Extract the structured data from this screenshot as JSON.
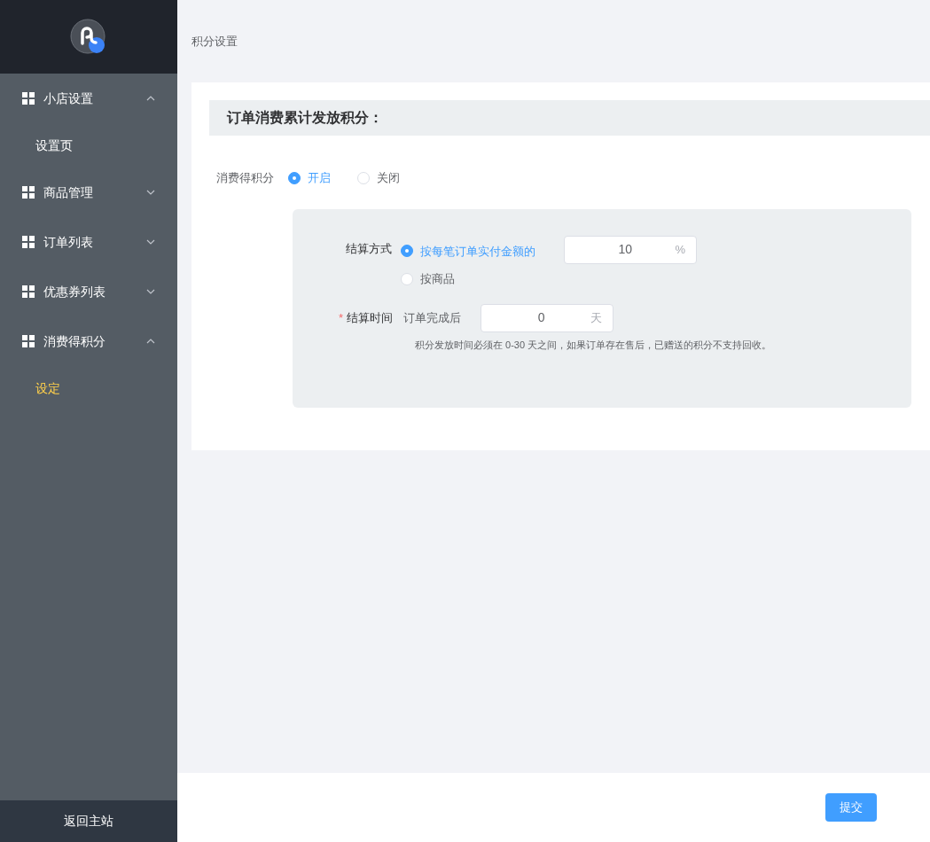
{
  "sidebar": {
    "groups": [
      {
        "label": "小店设置",
        "expanded": true,
        "children": [
          {
            "label": "设置页",
            "selected": false
          }
        ]
      },
      {
        "label": "商品管理",
        "expanded": false
      },
      {
        "label": "订单列表",
        "expanded": false
      },
      {
        "label": "优惠券列表",
        "expanded": false
      },
      {
        "label": "消费得积分",
        "expanded": true,
        "children": [
          {
            "label": "设定",
            "selected": true
          }
        ]
      }
    ],
    "footer_link": "返回主站"
  },
  "breadcrumb": "积分设置",
  "section_title": "订单消费累计发放积分：",
  "points_toggle": {
    "label": "消费得积分",
    "options": [
      {
        "label": "开启",
        "selected": true
      },
      {
        "label": "关闭",
        "selected": false
      }
    ]
  },
  "settlement_method": {
    "label": "结算方式",
    "options": [
      {
        "label": "按每笔订单实付金额的",
        "selected": true
      },
      {
        "label": "按商品",
        "selected": false
      }
    ],
    "input": {
      "value": "10",
      "suffix": "%"
    }
  },
  "settlement_time": {
    "required_mark": "*",
    "label": "结算时间",
    "prefix": "订单完成后",
    "input": {
      "value": "0",
      "suffix": "天"
    },
    "hint": "积分发放时间必须在 0-30 天之间，如果订单存在售后，已赠送的积分不支持回收。"
  },
  "submit_button": "提交"
}
